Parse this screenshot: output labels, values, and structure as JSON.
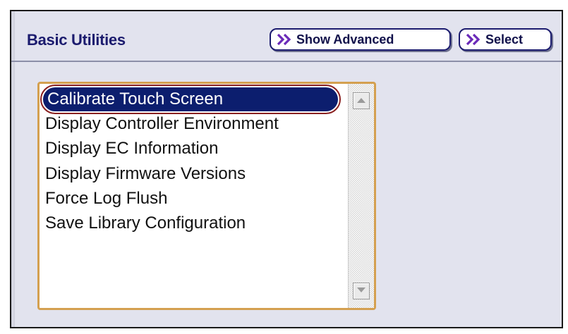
{
  "panel": {
    "title": "Basic Utilities",
    "buttons": {
      "show_advanced": {
        "label": "Show Advanced",
        "icon": "double-chevron-right-icon"
      },
      "select": {
        "label": "Select",
        "icon": "double-chevron-right-icon"
      }
    }
  },
  "listbox": {
    "selected_index": 0,
    "items": [
      {
        "label": "Calibrate Touch Screen"
      },
      {
        "label": "Display Controller Environment"
      },
      {
        "label": "Display EC Information"
      },
      {
        "label": "Display Firmware Versions"
      },
      {
        "label": "Force Log Flush"
      },
      {
        "label": "Save Library Configuration"
      }
    ],
    "scroll_up_icon": "arrow-up-icon",
    "scroll_down_icon": "arrow-down-icon"
  },
  "colors": {
    "panel_background": "#e2e3ee",
    "title_text": "#1b1b6e",
    "selection_background": "#0c1e6e",
    "selection_outline": "#8a2020",
    "listbox_border": "#d4a050",
    "chevron_icon": "#6a2ab8"
  }
}
